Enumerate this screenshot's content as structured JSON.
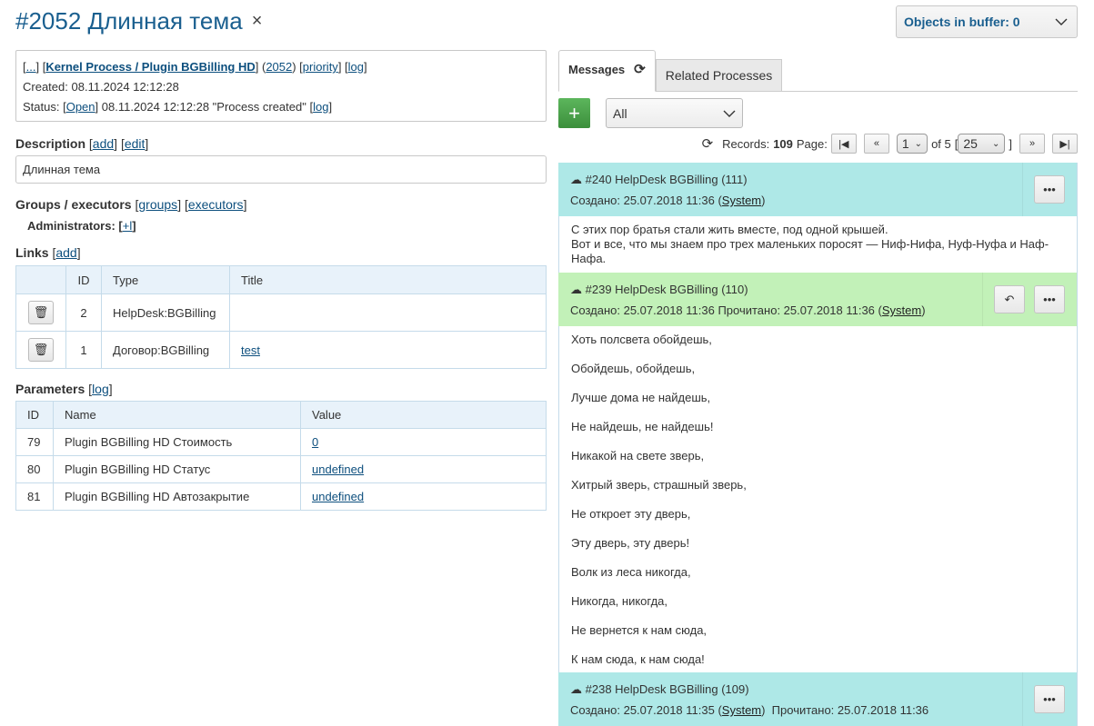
{
  "header": {
    "title": "#2052 Длинная тема",
    "close_symbol": "×",
    "buffer_label": "Objects in buffer: 0"
  },
  "process": {
    "ellipsis_link": "...",
    "type_link": "Kernel Process / Plugin BGBilling HD",
    "id_link": "2052",
    "priority_link": "priority",
    "log_link": "log",
    "created_label": "Created:",
    "created_value": "08.11.2024 12:12:28",
    "status_label": "Status:",
    "status_link": "Open",
    "status_text": "08.11.2024 12:12:28 \"Process created\"",
    "status_log_link": "log"
  },
  "description": {
    "heading": "Description",
    "add_link": "add",
    "edit_link": "edit",
    "value": "Длинная тема"
  },
  "groups": {
    "heading": "Groups / executors",
    "groups_link": "groups",
    "executors_link": "executors",
    "admin_label": "Administrators:",
    "admin_add_link": "+l"
  },
  "links": {
    "heading": "Links",
    "add_link": "add",
    "columns": [
      "",
      "ID",
      "Type",
      "Title"
    ],
    "rows": [
      {
        "id": "2",
        "type": "HelpDesk:BGBilling",
        "title": ""
      },
      {
        "id": "1",
        "type": "Договор:BGBilling",
        "title": "test"
      }
    ]
  },
  "parameters": {
    "heading": "Parameters",
    "log_link": "log",
    "columns": [
      "ID",
      "Name",
      "Value"
    ],
    "rows": [
      {
        "id": "79",
        "name": "Plugin BGBilling HD Стоимость",
        "value": "0"
      },
      {
        "id": "80",
        "name": "Plugin BGBilling HD Статус",
        "value": "undefined"
      },
      {
        "id": "81",
        "name": "Plugin BGBilling HD Автозакрытие",
        "value": "undefined"
      }
    ]
  },
  "tabs": [
    {
      "label": "Messages",
      "active": true
    },
    {
      "label": "Related Processes",
      "active": false
    }
  ],
  "toolbar": {
    "add_symbol": "+",
    "filter_value": "All"
  },
  "pager": {
    "records_label": "Records:",
    "records_count": "109",
    "page_label": "Page:",
    "current_page": "1",
    "of_label": "of 5",
    "page_size": "25",
    "first_symbol": "|◀",
    "prev_symbol": "«",
    "next_symbol": "»",
    "last_symbol": "▶|"
  },
  "messages": [
    {
      "title": "#240 HelpDesk BGBilling (111)",
      "created": "Создано: 25.07.2018 11:36 (",
      "user": "System",
      "after_user": ")",
      "read": "",
      "color": "#aee8e7",
      "body": [
        "С этих пор братья стали жить вместе, под одной крышей.",
        "Вот и все, что мы знаем про трех маленьких поросят — Ниф-Нифа, Нуф-Нуфа и Наф-Нафа."
      ]
    },
    {
      "title": "#239 HelpDesk BGBilling (110)",
      "created": "Создано: 25.07.2018 11:36  Прочитано: 25.07.2018 11:36 (",
      "user": "System",
      "after_user": ")",
      "color": "#c2f1b8",
      "body": [
        "Хоть полсвета обойдешь,",
        "Обойдешь, обойдешь,",
        "Лучше дома не найдешь,",
        "Не найдешь, не найдешь!",
        "Никакой на свете зверь,",
        "Хитрый зверь, страшный зверь,",
        "Не откроет эту дверь,",
        "Эту дверь, эту дверь!",
        "Волк из леса никогда,",
        "Никогда, никогда,",
        "Не вернется к нам сюда,",
        "К нам сюда, к нам сюда!"
      ]
    },
    {
      "title": "#238 HelpDesk BGBilling (109)",
      "created": "Создано: 25.07.2018 11:35 (",
      "user": "System",
      "after_user": ")  Прочитано: 25.07.2018 11:36",
      "color": "#aee8e7",
      "body": []
    }
  ]
}
